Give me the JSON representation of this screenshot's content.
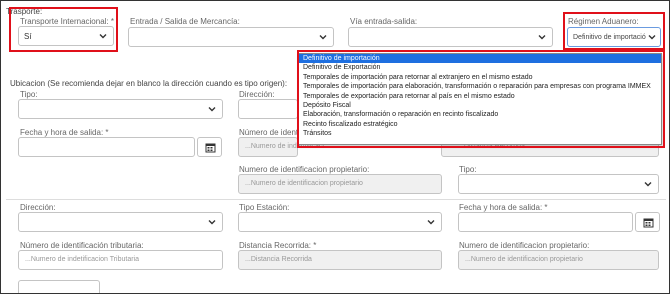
{
  "transporte": {
    "section_label": "Trasporte:",
    "internacional": {
      "label": "Transporte Internacional: *",
      "value": "Sí"
    },
    "entrada_salida": {
      "label": "Entrada / Salida de Mercancía:",
      "value": ""
    },
    "via": {
      "label": "Vía entrada-salida:",
      "value": ""
    },
    "regimen": {
      "label": "Régimen Aduanero:",
      "value": "Definitivo de importació",
      "options": [
        "Definitivo de importación",
        "Definitivo de Exportación",
        "Temporales de importación para retornar al extranjero en el mismo estado",
        "Temporales de importación para elaboración, transformación o reparación para empresas con programa IMMEX",
        "Temporales de exportación para retornar al país en el mismo estado",
        "Depósito Fiscal",
        "Elaboración, transformación o reparación en recinto fiscalizado",
        "Recinto fiscalizado estratégico",
        "Tránsitos"
      ]
    }
  },
  "ubicacion": {
    "section_label": "Ubicacion (Se recomienda dejar en blanco la dirección cuando es tipo origen):",
    "row1": {
      "tipo_label": "Tipo:",
      "direccion_label": "Dirección:"
    },
    "row2": {
      "fecha_label": "Fecha y hora de salida: *",
      "num_id_label": "Número de identi",
      "num_id_placeholder": "...Numero de indentificaci",
      "distancia_placeholder": "...Distancia Recorrida"
    },
    "row3": {
      "num_prop_label": "Numero de identificacion propietario:",
      "num_prop_placeholder": "...Numero de identificacion propietario",
      "tipo_label": "Tipo:"
    }
  },
  "ubicacion2": {
    "row1": {
      "direccion_label": "Dirección:",
      "tipo_estacion_label": "Tipo Estación:",
      "fecha_label": "Fecha y hora de salida: *"
    },
    "row2": {
      "num_trib_label": "Número de identificación tributaria:",
      "num_trib_placeholder": "...Numero de indetificacion Tributaria",
      "distancia_label": "Distancia Recorrida: *",
      "distancia_placeholder": "...Distancia Recorrida",
      "num_prop_label": "Numero de identificacion propietario:",
      "num_prop_placeholder": "...Numero de identificacion propietario"
    }
  },
  "colors": {
    "highlight": "#e0101a",
    "selected_option": "#1e6fe0"
  },
  "icons": {
    "select": "chevron-down-icon",
    "date": "calendar-icon"
  }
}
